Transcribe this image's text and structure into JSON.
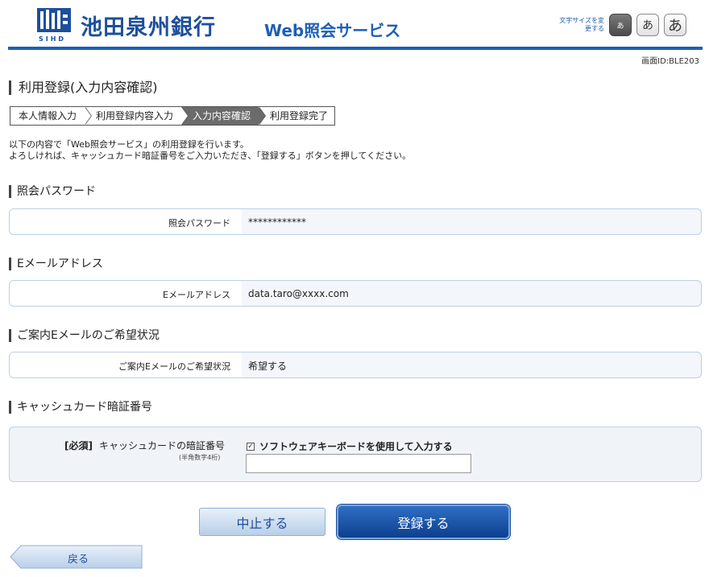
{
  "header": {
    "bank_name": "池田泉州銀行",
    "service_name": "Web照会サービス",
    "font_size_label": "文字サイズを変更する",
    "font_size_buttons": [
      "あ",
      "あ",
      "あ"
    ],
    "screen_id": "画面ID:BLE203"
  },
  "page": {
    "title": "利用登録(入力内容確認)",
    "steps": [
      {
        "label": "本人情報入力",
        "current": false
      },
      {
        "label": "利用登録内容入力",
        "current": false
      },
      {
        "label": "入力内容確認",
        "current": true
      },
      {
        "label": "利用登録完了",
        "current": false
      }
    ],
    "intro_line1": "以下の内容で「Web照会サービス」の利用登録を行います。",
    "intro_line2": "よろしければ、キャッシュカード暗証番号をご入力いただき、「登録する」ボタンを押してください。"
  },
  "sections": {
    "password": {
      "title": "照会パスワード",
      "label": "照会パスワード",
      "value": "************"
    },
    "email": {
      "title": "Eメールアドレス",
      "label": "Eメールアドレス",
      "value": "data.taro@xxxx.com"
    },
    "guidance": {
      "title": "ご案内Eメールのご希望状況",
      "label": "ご案内Eメールのご希望状況",
      "value": "希望する"
    },
    "pin": {
      "title": "キャッシュカード暗証番号",
      "required": "[必須]",
      "label": "キャッシュカードの暗証番号",
      "note": "(半角数字4桁)",
      "software_keyboard_label": "ソフトウェアキーボードを使用して入力する",
      "software_keyboard_checked": true,
      "input_value": ""
    }
  },
  "buttons": {
    "cancel": "中止する",
    "register": "登録する",
    "back": "戻る"
  },
  "colors": {
    "brand": "#1d5fb4",
    "register_button": "#0d3f8e",
    "row_background": "#f3f6fa"
  }
}
